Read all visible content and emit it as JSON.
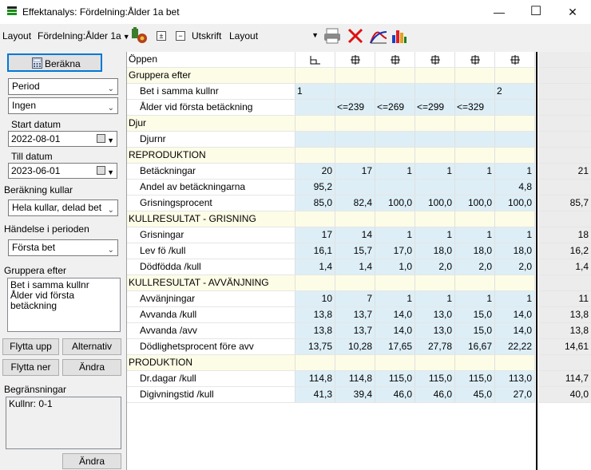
{
  "window": {
    "title": "Effektanalys: Fördelning:Ålder 1a bet",
    "min": "—",
    "max": "☐",
    "close": "✕"
  },
  "toolbar": {
    "layout_label": "Layout",
    "layout_value": "Fördelning:Ålder 1a",
    "utskrift_label": "Utskrift",
    "layout_combo_value": "Layout",
    "plus_glyph": "±",
    "minus_glyph": "−"
  },
  "left": {
    "calculate": "Beräkna",
    "period_combo": "Period",
    "ingen_combo": "Ingen",
    "start_label": "Start datum",
    "start_value": "2022-08-01",
    "end_label": "Till datum",
    "end_value": "2023-06-01",
    "litter_calc_label": "Beräkning kullar",
    "litter_calc_value": "Hela kullar, delad bet",
    "event_label": "Händelse i perioden",
    "event_value": "Första bet",
    "group_label": "Gruppera efter",
    "group_items": [
      "Bet i samma kullnr",
      "Ålder vid första betäckning"
    ],
    "move_up": "Flytta upp",
    "alternative": "Alternativ",
    "move_down": "Flytta ner",
    "change1": "Ändra",
    "limits_label": "Begränsningar",
    "limits_items": [
      "Kullnr: 0-1"
    ],
    "change2": "Ändra"
  },
  "grid": {
    "open_label": "Öppen",
    "rows": [
      {
        "kind": "sec",
        "label": "Gruppera efter"
      },
      {
        "kind": "item",
        "label": "Bet i samma kullnr",
        "vals": [
          "1",
          "",
          "",
          "",
          "",
          "2",
          ""
        ],
        "align": "left"
      },
      {
        "kind": "item",
        "label": "Ålder vid första betäckning",
        "vals": [
          "",
          "<=239",
          "<=269",
          "<=299",
          "<=329",
          "",
          ""
        ],
        "align": "left"
      },
      {
        "kind": "sec",
        "label": "Djur"
      },
      {
        "kind": "item",
        "label": "Djurnr",
        "vals": [
          "",
          "",
          "",
          "",
          "",
          "",
          ""
        ]
      },
      {
        "kind": "sec",
        "label": "REPRODUKTION"
      },
      {
        "kind": "item",
        "label": "Betäckningar",
        "vals": [
          "20",
          "17",
          "1",
          "1",
          "1",
          "1",
          "21"
        ]
      },
      {
        "kind": "item",
        "label": "Andel av betäckningarna",
        "vals": [
          "95,2",
          "",
          "",
          "",
          "",
          "4,8",
          ""
        ]
      },
      {
        "kind": "item",
        "label": "Grisningsprocent",
        "vals": [
          "85,0",
          "82,4",
          "100,0",
          "100,0",
          "100,0",
          "100,0",
          "85,7"
        ]
      },
      {
        "kind": "sec",
        "label": "KULLRESULTAT - GRISNING"
      },
      {
        "kind": "item",
        "label": "Grisningar",
        "vals": [
          "17",
          "14",
          "1",
          "1",
          "1",
          "1",
          "18"
        ]
      },
      {
        "kind": "item",
        "label": "Lev fö /kull",
        "vals": [
          "16,1",
          "15,7",
          "17,0",
          "18,0",
          "18,0",
          "18,0",
          "16,2"
        ]
      },
      {
        "kind": "item",
        "label": "Dödfödda /kull",
        "vals": [
          "1,4",
          "1,4",
          "1,0",
          "2,0",
          "2,0",
          "2,0",
          "1,4"
        ]
      },
      {
        "kind": "sec",
        "label": "KULLRESULTAT - AVVÄNJNING"
      },
      {
        "kind": "item",
        "label": "Avvänjningar",
        "vals": [
          "10",
          "7",
          "1",
          "1",
          "1",
          "1",
          "11"
        ]
      },
      {
        "kind": "item",
        "label": "Avvanda /kull",
        "vals": [
          "13,8",
          "13,7",
          "14,0",
          "13,0",
          "15,0",
          "14,0",
          "13,8"
        ]
      },
      {
        "kind": "item",
        "label": "Avvanda /avv",
        "vals": [
          "13,8",
          "13,7",
          "14,0",
          "13,0",
          "15,0",
          "14,0",
          "13,8"
        ]
      },
      {
        "kind": "item",
        "label": "Dödlighetsprocent före avv",
        "vals": [
          "13,75",
          "10,28",
          "17,65",
          "27,78",
          "16,67",
          "22,22",
          "14,61"
        ]
      },
      {
        "kind": "sec",
        "label": "PRODUKTION"
      },
      {
        "kind": "item",
        "label": "Dr.dagar /kull",
        "vals": [
          "114,8",
          "114,8",
          "115,0",
          "115,0",
          "115,0",
          "113,0",
          "114,7"
        ]
      },
      {
        "kind": "item",
        "label": "Digivningstid /kull",
        "vals": [
          "41,3",
          "39,4",
          "46,0",
          "46,0",
          "45,0",
          "27,0",
          "40,0"
        ]
      }
    ]
  },
  "colors": {
    "section_bg": "#fdfce6",
    "value_bg": "#ddeef6",
    "total_bg": "#ececec",
    "accent": "#0078d7"
  }
}
